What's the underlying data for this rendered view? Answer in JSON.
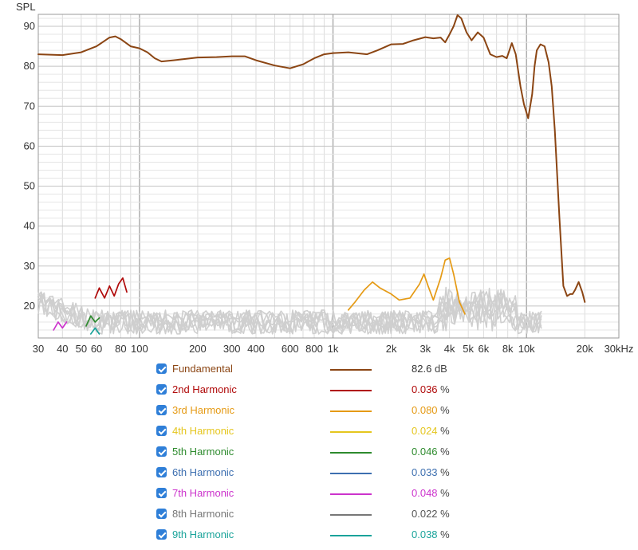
{
  "chart_data": {
    "type": "line",
    "title": "",
    "ylabel": "SPL",
    "xscale": "log",
    "xlim": [
      30,
      30000
    ],
    "ylim": [
      12,
      93
    ],
    "grid": true,
    "x_ticks": [
      30,
      40,
      50,
      60,
      80,
      100,
      200,
      300,
      400,
      600,
      800,
      1000,
      2000,
      3000,
      4000,
      5000,
      6000,
      8000,
      10000,
      20000,
      30000
    ],
    "x_tick_labels": [
      "30",
      "40",
      "50",
      "60",
      "80",
      "100",
      "200",
      "300",
      "400",
      "600",
      "800",
      "1k",
      "2k",
      "3k",
      "4k",
      "5k",
      "6k",
      "8k",
      "10k",
      "20k",
      "30kHz"
    ],
    "y_ticks": [
      20,
      30,
      40,
      50,
      60,
      70,
      80,
      90
    ],
    "y_tick_labels": [
      "20",
      "30",
      "40",
      "50",
      "60",
      "70",
      "80",
      "90"
    ],
    "series": [
      {
        "name": "Fundamental",
        "color": "#8b4513",
        "x": [
          30,
          40,
          50,
          60,
          70,
          75,
          80,
          90,
          100,
          110,
          120,
          130,
          150,
          200,
          250,
          300,
          350,
          400,
          500,
          600,
          700,
          800,
          900,
          1000,
          1200,
          1500,
          1700,
          2000,
          2300,
          2600,
          3000,
          3300,
          3600,
          3800,
          4000,
          4200,
          4400,
          4600,
          4900,
          5200,
          5600,
          6000,
          6500,
          7000,
          7500,
          7900,
          8400,
          8800,
          9300,
          9700,
          10200,
          10700,
          11000,
          11300,
          11800,
          12400,
          13000,
          13500,
          14000,
          14800,
          15500,
          16200,
          16800,
          17300,
          17800,
          18600,
          19400,
          20000
        ],
        "y": [
          83,
          82.8,
          83.5,
          85,
          87.2,
          87.5,
          86.8,
          85,
          84.5,
          83.5,
          82,
          81.2,
          81.5,
          82.2,
          82.3,
          82.5,
          82.5,
          81.5,
          80.2,
          79.5,
          80.5,
          82,
          83,
          83.3,
          83.5,
          83,
          84,
          85.5,
          85.6,
          86.5,
          87.3,
          87,
          87.2,
          86,
          88,
          90,
          92.8,
          92,
          88.5,
          86.5,
          88.5,
          87.2,
          83,
          82.3,
          82.6,
          82,
          85.8,
          83,
          75,
          70.5,
          67,
          73,
          80,
          84,
          85.5,
          85,
          81,
          75,
          64,
          42,
          25,
          22.5,
          23,
          23,
          24,
          26,
          23.5,
          21
        ]
      },
      {
        "name": "2nd Harmonic",
        "color": "#b00a0a",
        "x": [
          59,
          62,
          66,
          70,
          74,
          78,
          82,
          86
        ],
        "y": [
          22,
          24.5,
          22,
          25,
          22.5,
          25.5,
          27,
          23.5
        ]
      },
      {
        "name": "3rd Harmonic",
        "color": "#e59a14",
        "x": [
          1200,
          1300,
          1450,
          1600,
          1750,
          2000,
          2200,
          2500,
          2800,
          2950,
          3100,
          3300,
          3600,
          3800,
          4000,
          4200,
          4500,
          4800
        ],
        "y": [
          19,
          21,
          24,
          26,
          24.5,
          23,
          21.5,
          22,
          25.5,
          28,
          25,
          21.5,
          27,
          31.5,
          32,
          28,
          21,
          18
        ]
      },
      {
        "name": "4th Harmonic",
        "color": "#e5c61e",
        "x": [],
        "y": []
      },
      {
        "name": "5th Harmonic",
        "color": "#2e8b2e",
        "x": [
          53,
          56,
          59,
          62
        ],
        "y": [
          15,
          17.5,
          16,
          17
        ]
      },
      {
        "name": "6th Harmonic",
        "color": "#3d6fb0",
        "x": [],
        "y": []
      },
      {
        "name": "7th Harmonic",
        "color": "#cc33cc",
        "x": [
          36,
          38,
          40,
          42
        ],
        "y": [
          14,
          16,
          14.5,
          16
        ]
      },
      {
        "name": "8th Harmonic",
        "color": "#777777",
        "x": [],
        "y": []
      },
      {
        "name": "9th Harmonic",
        "color": "#1aa39a",
        "x": [
          56,
          59,
          62
        ],
        "y": [
          13,
          14.5,
          13
        ]
      }
    ]
  },
  "legend": [
    {
      "name": "Fundamental",
      "color": "#8b4513",
      "value": "82.6",
      "unit": "dB",
      "value_color": "#333333"
    },
    {
      "name": "2nd Harmonic",
      "color": "#b00a0a",
      "value": "0.036",
      "unit": "%",
      "value_color": "#b00a0a"
    },
    {
      "name": "3rd Harmonic",
      "color": "#e59a14",
      "value": "0.080",
      "unit": "%",
      "value_color": "#e59a14"
    },
    {
      "name": "4th Harmonic",
      "color": "#e5c61e",
      "value": "0.024",
      "unit": "%",
      "value_color": "#e5c61e"
    },
    {
      "name": "5th Harmonic",
      "color": "#2e8b2e",
      "value": "0.046",
      "unit": "%",
      "value_color": "#2e8b2e"
    },
    {
      "name": "6th Harmonic",
      "color": "#3d6fb0",
      "value": "0.033",
      "unit": "%",
      "value_color": "#3d6fb0"
    },
    {
      "name": "7th Harmonic",
      "color": "#cc33cc",
      "value": "0.048",
      "unit": "%",
      "value_color": "#cc33cc"
    },
    {
      "name": "8th Harmonic",
      "color": "#777777",
      "value": "0.022",
      "unit": "%",
      "value_color": "#555555"
    },
    {
      "name": "9th Harmonic",
      "color": "#1aa39a",
      "value": "0.038",
      "unit": "%",
      "value_color": "#1aa39a"
    }
  ]
}
